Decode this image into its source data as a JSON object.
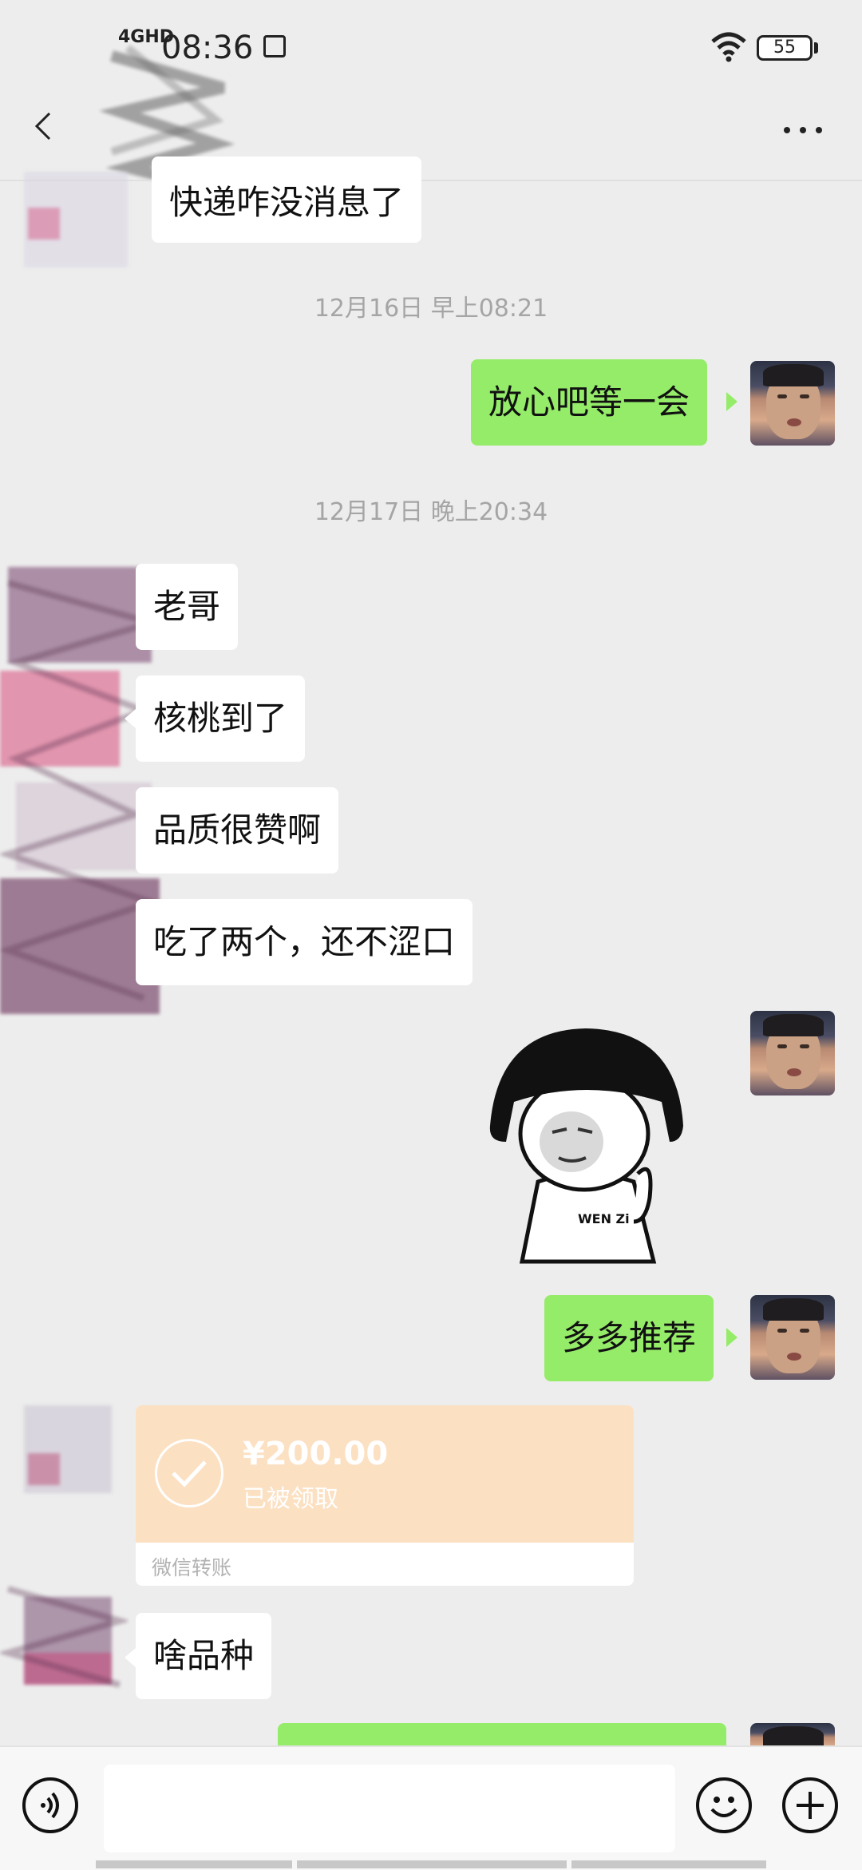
{
  "status_bar": {
    "network": "4GHD",
    "time": "08:36",
    "battery": "55"
  },
  "messages": {
    "m1": "快递咋没消息了",
    "ts1": "12月16日 早上08:21",
    "m2": "放心吧等一会",
    "ts2": "12月17日 晚上20:34",
    "m3": "老哥",
    "m4": "核桃到了",
    "m5": "品质很赞啊",
    "m6": "吃了两个，还不涩口",
    "sticker_text": "WEN Zi",
    "m7": "多多推荐",
    "m8": "啥品种"
  },
  "transfer": {
    "amount": "¥200.00",
    "status": "已被领取",
    "label": "微信转账"
  },
  "colors": {
    "sent_bubble": "#95ec69",
    "received_bubble": "#ffffff",
    "background": "#ededed",
    "transfer_card": "#fce0c2"
  }
}
